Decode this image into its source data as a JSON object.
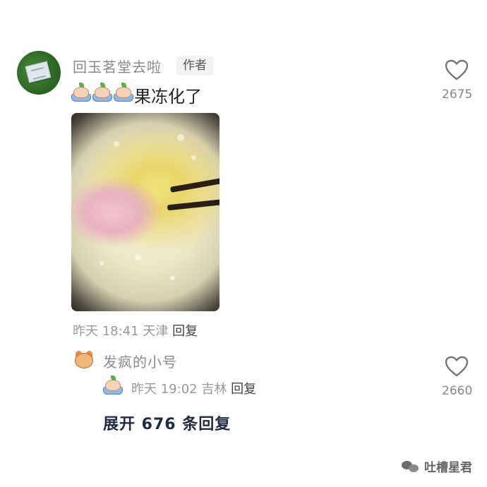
{
  "comment": {
    "username": "回玉茗堂去啦",
    "author_badge": "作者",
    "emojis": [
      "peach-bath-emoji",
      "peach-bath-emoji",
      "peach-bath-emoji"
    ],
    "text": "果冻化了",
    "meta": {
      "time": "昨天 18:41",
      "location": "天津",
      "reply_label": "回复"
    },
    "like_count": "2675"
  },
  "reply": {
    "username": "发疯的小号",
    "emoji": "peach-bath-emoji",
    "meta": {
      "time": "昨天 19:02",
      "location": "吉林",
      "reply_label": "回复"
    },
    "like_count": "2660"
  },
  "expand_replies": "展开 676 条回复",
  "watermark": "吐槽星君",
  "colors": {
    "username": "#8a8a8a",
    "meta": "#999999",
    "expand": "#1f2b45"
  }
}
